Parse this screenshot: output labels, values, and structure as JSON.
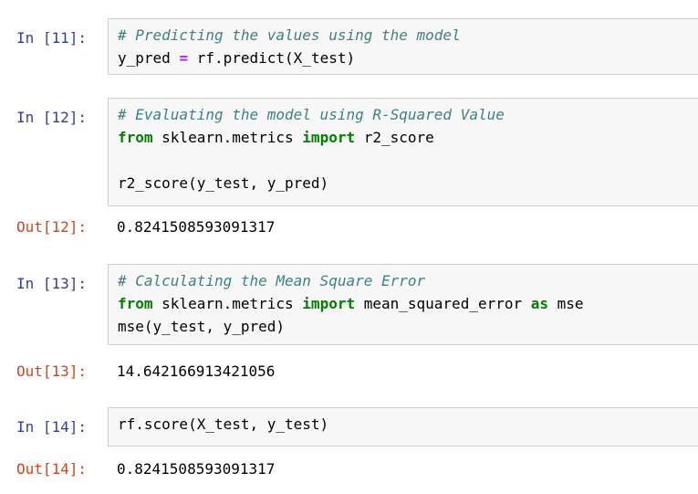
{
  "cells": {
    "c11": {
      "in_prompt": "In [11]:",
      "comment": "# Predicting the values using the model",
      "line2_var": "y_pred ",
      "line2_op": "=",
      "line2_rest": " rf.predict(X_test)"
    },
    "c12": {
      "in_prompt": "In [12]:",
      "comment": "# Evaluating the model using R-Squared Value",
      "from_kw": "from",
      "module": " sklearn.metrics ",
      "import_kw": "import",
      "imported": " r2_score",
      "call": "r2_score(y_test, y_pred)",
      "out_prompt": "Out[12]:",
      "output": "0.8241508593091317"
    },
    "c13": {
      "in_prompt": "In [13]:",
      "comment": "# Calculating the Mean Square Error",
      "from_kw": "from",
      "module": " sklearn.metrics ",
      "import_kw": "import",
      "imported": " mean_squared_error ",
      "as_kw": "as",
      "alias": " mse",
      "call": "mse(y_test, y_pred)",
      "out_prompt": "Out[13]:",
      "output": "14.642166913421056"
    },
    "c14": {
      "in_prompt": "In [14]:",
      "call": "rf.score(X_test, y_test)",
      "out_prompt": "Out[14]:",
      "output": "0.8241508593091317"
    }
  },
  "colors": {
    "in_prompt": "#303f9f",
    "out_prompt": "#d84315",
    "comment": "#408080",
    "keyword": "#008000",
    "operator": "#aa22ff",
    "cell_background": "#f7f7f7",
    "cell_border": "#cfcfcf"
  }
}
